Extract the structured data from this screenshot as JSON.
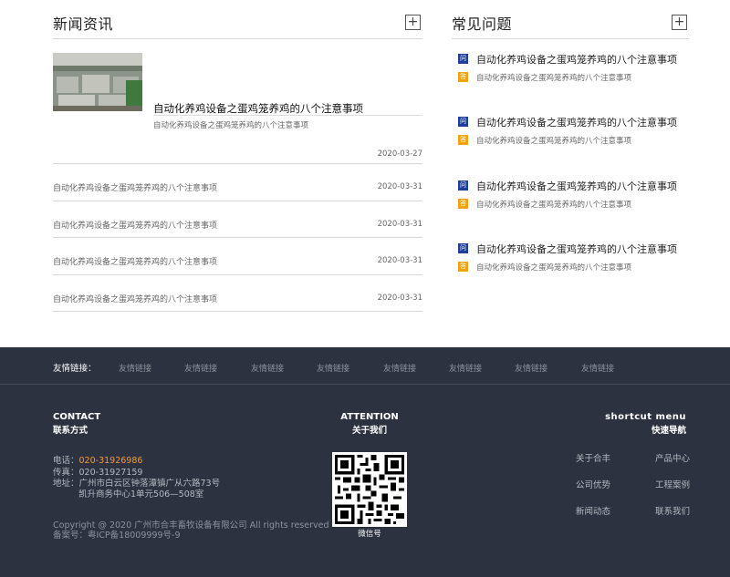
{
  "news": {
    "title": "新闻资讯",
    "more_icon": "+",
    "featured": {
      "title": "自动化养鸡设备之蛋鸡笼养鸡的八个注意事项",
      "summary": "自动化养鸡设备之蛋鸡笼养鸡的八个注意事项",
      "date": "2020-03-27"
    },
    "items": [
      {
        "title": "自动化养鸡设备之蛋鸡笼养鸡的八个注意事项",
        "date": "2020-03-31"
      },
      {
        "title": "自动化养鸡设备之蛋鸡笼养鸡的八个注意事项",
        "date": "2020-03-31"
      },
      {
        "title": "自动化养鸡设备之蛋鸡笼养鸡的八个注意事项",
        "date": "2020-03-31"
      },
      {
        "title": "自动化养鸡设备之蛋鸡笼养鸡的八个注意事项",
        "date": "2020-03-31"
      }
    ]
  },
  "faq": {
    "title": "常见问题",
    "more_icon": "+",
    "q_badge": "问",
    "a_badge": "答",
    "items": [
      {
        "question": "自动化养鸡设备之蛋鸡笼养鸡的八个注意事项",
        "answer": "自动化养鸡设备之蛋鸡笼养鸡的八个注意事项"
      },
      {
        "question": "自动化养鸡设备之蛋鸡笼养鸡的八个注意事项",
        "answer": "自动化养鸡设备之蛋鸡笼养鸡的八个注意事项"
      },
      {
        "question": "自动化养鸡设备之蛋鸡笼养鸡的八个注意事项",
        "answer": "自动化养鸡设备之蛋鸡笼养鸡的八个注意事项"
      },
      {
        "question": "自动化养鸡设备之蛋鸡笼养鸡的八个注意事项",
        "answer": "自动化养鸡设备之蛋鸡笼养鸡的八个注意事项"
      }
    ]
  },
  "footer": {
    "links_label": "友情链接：",
    "links": [
      "友情链接",
      "友情链接",
      "友情链接",
      "友情链接",
      "友情链接",
      "友情链接",
      "友情链接",
      "友情链接"
    ],
    "contact": {
      "title_en": "CONTACT",
      "title_cn": "联系方式",
      "phone_label": "电话：",
      "phone": "020-31926986",
      "fax_label": "传真：",
      "fax": "020-31927159",
      "address_label": "地址：",
      "address_line1": "广州市白云区钟落潭镇广从六路73号",
      "address_line2": "凯升商务中心1单元506—508室",
      "copyright": "Copyright @ 2020 广州市合丰畜牧设备有限公司 All rights reserved",
      "icp": "备案号：粤ICP备18009999号-9"
    },
    "attention": {
      "title_en": "ATTENTION",
      "title_cn": "关于我们",
      "qr_caption": "微信号"
    },
    "shortcut": {
      "title_en": "shortcut menu",
      "title_cn": "快速导航",
      "links": [
        "关于合丰",
        "产品中心",
        "公司优势",
        "工程案例",
        "新闻动态",
        "联系我们"
      ]
    }
  }
}
